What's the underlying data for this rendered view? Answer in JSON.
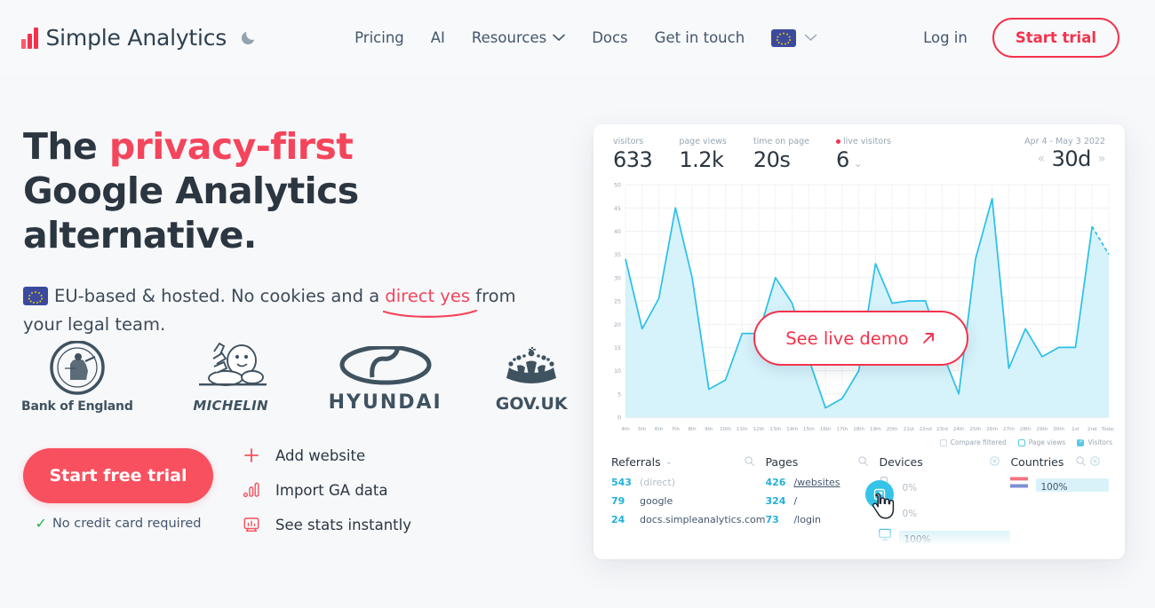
{
  "nav": {
    "brand": "Simple Analytics",
    "theme_toggle_icon": "moon-icon",
    "links": [
      {
        "label": "Pricing",
        "has_chevron": false
      },
      {
        "label": "AI",
        "has_chevron": false
      },
      {
        "label": "Resources",
        "has_chevron": true
      },
      {
        "label": "Docs",
        "has_chevron": false
      },
      {
        "label": "Get in touch",
        "has_chevron": false
      }
    ],
    "language_flag": "eu-flag-icon",
    "login_label": "Log in",
    "start_trial_label": "Start trial"
  },
  "hero": {
    "headline_line1_plain": "The ",
    "headline_line1_accent": "privacy-first",
    "headline_line2": "Google Analytics alternative.",
    "subhead_part1": "EU-based & hosted. No cookies and a ",
    "subhead_link": "direct yes",
    "subhead_part2": " from your legal team.",
    "cta_label": "Start free trial",
    "cta_note": "No credit card required",
    "features": [
      {
        "icon": "plus-icon",
        "label": "Add website"
      },
      {
        "icon": "bar-chart-icon",
        "label": "Import GA data"
      },
      {
        "icon": "monitor-stats-icon",
        "label": "See stats instantly"
      }
    ],
    "logos": [
      {
        "name": "bank-of-england-logo",
        "caption": "Bank of England"
      },
      {
        "name": "michelin-logo",
        "caption": "MICHELIN"
      },
      {
        "name": "hyundai-logo",
        "caption": "HYUNDAI"
      },
      {
        "name": "gov-uk-logo",
        "caption": "GOV.UK"
      }
    ]
  },
  "demo_button": {
    "label": "See live demo",
    "icon": "arrow-up-right-icon"
  },
  "dashboard": {
    "stats": [
      {
        "label": "visitors",
        "value": "633",
        "live": false,
        "chevron": false
      },
      {
        "label": "page views",
        "value": "1.2k",
        "live": false,
        "chevron": false
      },
      {
        "label": "time on page",
        "value": "20s",
        "live": false,
        "chevron": false
      },
      {
        "label": "live visitors",
        "value": "6",
        "live": true,
        "chevron": true
      }
    ],
    "date_range_label": "Apr 4 - May 3 2022",
    "date_range_value": "30d",
    "prev_icon": "chevron-left-icon",
    "next_icon": "chevron-right-icon",
    "legend": [
      {
        "label": "Compare filtered",
        "checked": false,
        "color": "#cfd8e0"
      },
      {
        "label": "Page views",
        "checked": false,
        "color": "#5bc8e8"
      },
      {
        "label": "Visitors",
        "checked": true,
        "color": "#5bc8e8"
      }
    ],
    "tables": {
      "referrals": {
        "title": "Referrals",
        "has_chevron": true,
        "search_icon": "search-icon",
        "rows": [
          {
            "count": "543",
            "label": "(direct)",
            "muted": true
          },
          {
            "count": "79",
            "label": "google",
            "muted": false
          },
          {
            "count": "24",
            "label": "docs.simpleanalytics.com",
            "muted": false
          }
        ]
      },
      "pages": {
        "title": "Pages",
        "search_icon": "search-icon",
        "rows": [
          {
            "count": "426",
            "label": "/websites",
            "link": true
          },
          {
            "count": "324",
            "label": "/",
            "link": false
          },
          {
            "count": "73",
            "label": "/login",
            "link": false
          }
        ]
      },
      "devices": {
        "title": "Devices",
        "close_icon": "close-circle-icon",
        "rows": [
          {
            "icon": "mobile-icon",
            "label": "0%",
            "percent": 0,
            "muted": true
          },
          {
            "icon": "tablet-icon",
            "label": "0%",
            "percent": 0,
            "muted": true
          },
          {
            "icon": "desktop-icon",
            "label": "100%",
            "percent": 100,
            "muted": false
          }
        ]
      },
      "countries": {
        "title": "Countries",
        "search_icon": "search-icon",
        "close_icon": "close-circle-icon",
        "rows": [
          {
            "icon": "netherlands-flag-icon",
            "label": "100%",
            "percent": 100,
            "muted": false
          }
        ]
      }
    }
  },
  "chart_data": {
    "type": "area",
    "title": "",
    "xlabel": "",
    "ylabel": "",
    "ylim": [
      0,
      50
    ],
    "yticks": [
      0,
      5,
      10,
      15,
      20,
      25,
      30,
      35,
      40,
      45,
      50
    ],
    "grid": true,
    "legend_position": "bottom-right",
    "line_color": "#29c0e8",
    "fill_color": "#d4f1fa",
    "categories": [
      "4th",
      "5th",
      "6th",
      "7th",
      "8th",
      "9th",
      "10th",
      "11th",
      "12th",
      "13th",
      "14th",
      "15th",
      "16th",
      "17th",
      "18th",
      "19th",
      "20th",
      "21st",
      "22nd",
      "23rd",
      "24th",
      "25th",
      "26th",
      "27th",
      "28th",
      "29th",
      "30th",
      "1st",
      "2nd",
      "Today"
    ],
    "series": [
      {
        "name": "Visitors",
        "values": [
          34,
          19,
          25.5,
          45,
          30,
          6,
          8,
          18,
          18,
          30,
          24.5,
          12.5,
          2,
          4,
          10,
          33,
          24.5,
          25,
          25,
          14,
          5,
          34,
          47,
          10.5,
          19,
          13,
          15,
          15,
          41,
          35
        ]
      }
    ],
    "last_point_dashed": true
  }
}
